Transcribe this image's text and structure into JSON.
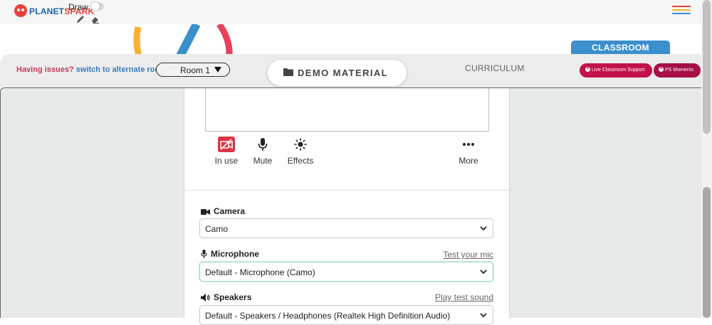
{
  "brand": {
    "logo_part1": "PLANET",
    "logo_part2": "SPARK"
  },
  "toolbar": {
    "draw_label": "Draw"
  },
  "colors": {
    "accent_blue": "#3b8fcd",
    "support_red": "#c2124a",
    "ps_red": "#a70e45",
    "warning_text": "#c43b54",
    "link_blue": "#3b7cc0"
  },
  "header": {
    "issues_text": "Having issues?",
    "alternate_link": "switch to alternate room",
    "room_select": "Room 1",
    "demo_material": "DEMO MATERIAL",
    "curriculum": "CURRICULUM",
    "classroom_tab": "CLASSROOM",
    "live_support": "Live Classroom Support",
    "ps_moments": "PS Moments"
  },
  "controls": {
    "in_use": "In use",
    "mute": "Mute",
    "effects": "Effects",
    "more": "More"
  },
  "devices": {
    "camera": {
      "label": "Camera",
      "value": "Camo"
    },
    "microphone": {
      "label": "Microphone",
      "link": "Test your mic",
      "value": "Default - Microphone (Camo)"
    },
    "speakers": {
      "label": "Speakers",
      "link": "Play test sound",
      "value": "Default - Speakers / Headphones (Realtek High Definition Audio)"
    }
  }
}
